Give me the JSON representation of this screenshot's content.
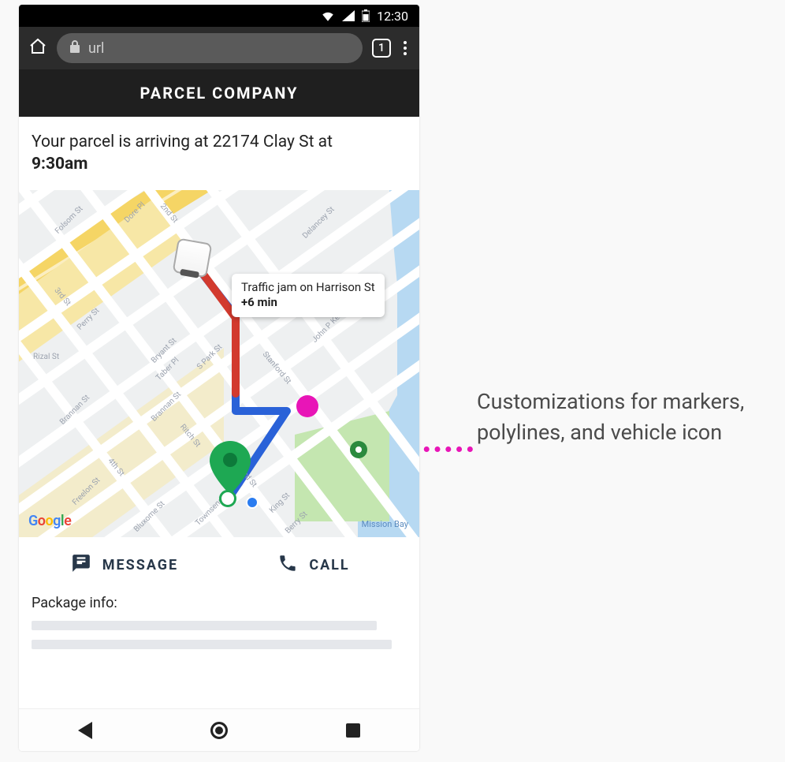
{
  "statusbar": {
    "time": "12:30"
  },
  "browser": {
    "url_text": "url",
    "tab_count": "1"
  },
  "app": {
    "title": "PARCEL COMPANY"
  },
  "arrival": {
    "prefix": "Your parcel is arriving at ",
    "address": "22174 Clay St",
    "suffix": " at",
    "time": "9:30am"
  },
  "map": {
    "callout_title": "Traffic jam on Harrison St",
    "callout_delay": "+6 min",
    "attribution": "Google",
    "area_label": "Mission Bay",
    "street_labels": {
      "folsom": "Folsom St",
      "dore": "Dore Pl",
      "second": "2nd St",
      "delancey": "Delancey St",
      "third_a": "3rd St",
      "perry": "Perry St",
      "rizal": "Rizal St",
      "bryant": "Bryant St",
      "taber": "Taber Pl",
      "spark": "S Park St",
      "jpkelly": "John P Kelly Jr St",
      "stanford": "Stanford St",
      "brannan_a": "Brannan St",
      "brannan_b": "Brannan St",
      "ritch": "Ritch St",
      "fourth": "4th St",
      "freelon": "Freelon St",
      "third_b": "3rd St",
      "king": "King St",
      "townsend": "Townsend St",
      "bluxome": "Bluxome St",
      "berry": "Berry St"
    }
  },
  "actions": {
    "message": "MESSAGE",
    "call": "CALL"
  },
  "package": {
    "heading": "Package info:"
  },
  "annotation": {
    "text": "Customizations for markers, polylines, and vehicle icon"
  }
}
